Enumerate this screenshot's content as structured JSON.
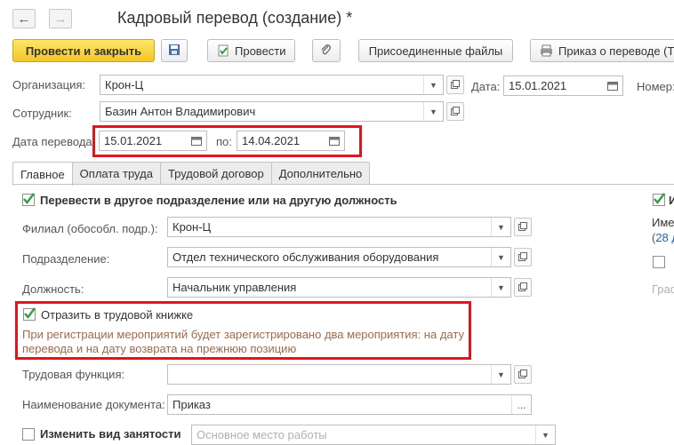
{
  "window": {
    "title": "Кадровый перевод (создание) *",
    "nav_back": "←",
    "nav_forward": "→"
  },
  "toolbar": {
    "post_and_close": "Провести и закрыть",
    "post": "Провести",
    "attached_files": "Присоединенные файлы",
    "order": "Приказ о переводе (Т-"
  },
  "header": {
    "organization_label": "Организация:",
    "organization_value": "Крон-Ц",
    "date_label": "Дата:",
    "date_value": "15.01.2021",
    "number_label": "Номер:",
    "employee_label": "Сотрудник:",
    "employee_value": "Базин Антон Владимирович",
    "transfer_date_label": "Дата перевода:",
    "transfer_date_from": "15.01.2021",
    "to_label": "по:",
    "transfer_date_to": "14.04.2021"
  },
  "tabs": [
    "Главное",
    "Оплата труда",
    "Трудовой договор",
    "Дополнительно"
  ],
  "main": {
    "transfer_checkbox_label": "Перевести в другое подразделение или на другую должность",
    "branch_label": "Филиал (обособл. подр.):",
    "branch_value": "Крон-Ц",
    "department_label": "Подразделение:",
    "department_value": "Отдел технического обслуживания оборудования",
    "position_label": "Должность:",
    "position_value": "Начальник управления",
    "workbook_checkbox_label": "Отразить в трудовой книжке",
    "note_line1": "При регистрации мероприятий будет зарегистрировано два мероприятия: на дату",
    "note_line2": "перевода и на дату возврата на прежнюю позицию",
    "labor_function_label": "Трудовая функция:",
    "labor_function_value": "",
    "document_name_label": "Наименование документа:",
    "document_name_value": "Приказ",
    "employment_type_label": "Изменить вид занятости",
    "employment_type_value": "Основное место работы",
    "dots": "..."
  },
  "right_panel": {
    "cb_label": "И",
    "text1": "Име",
    "text2": "(28 д",
    "text3": "Граф"
  },
  "colors": {
    "primary_button": "#f5c628",
    "highlight_border": "#e0161d",
    "checkmark": "#2f9e3f",
    "note_text": "#a06a4a",
    "link": "#2a5ca8"
  }
}
